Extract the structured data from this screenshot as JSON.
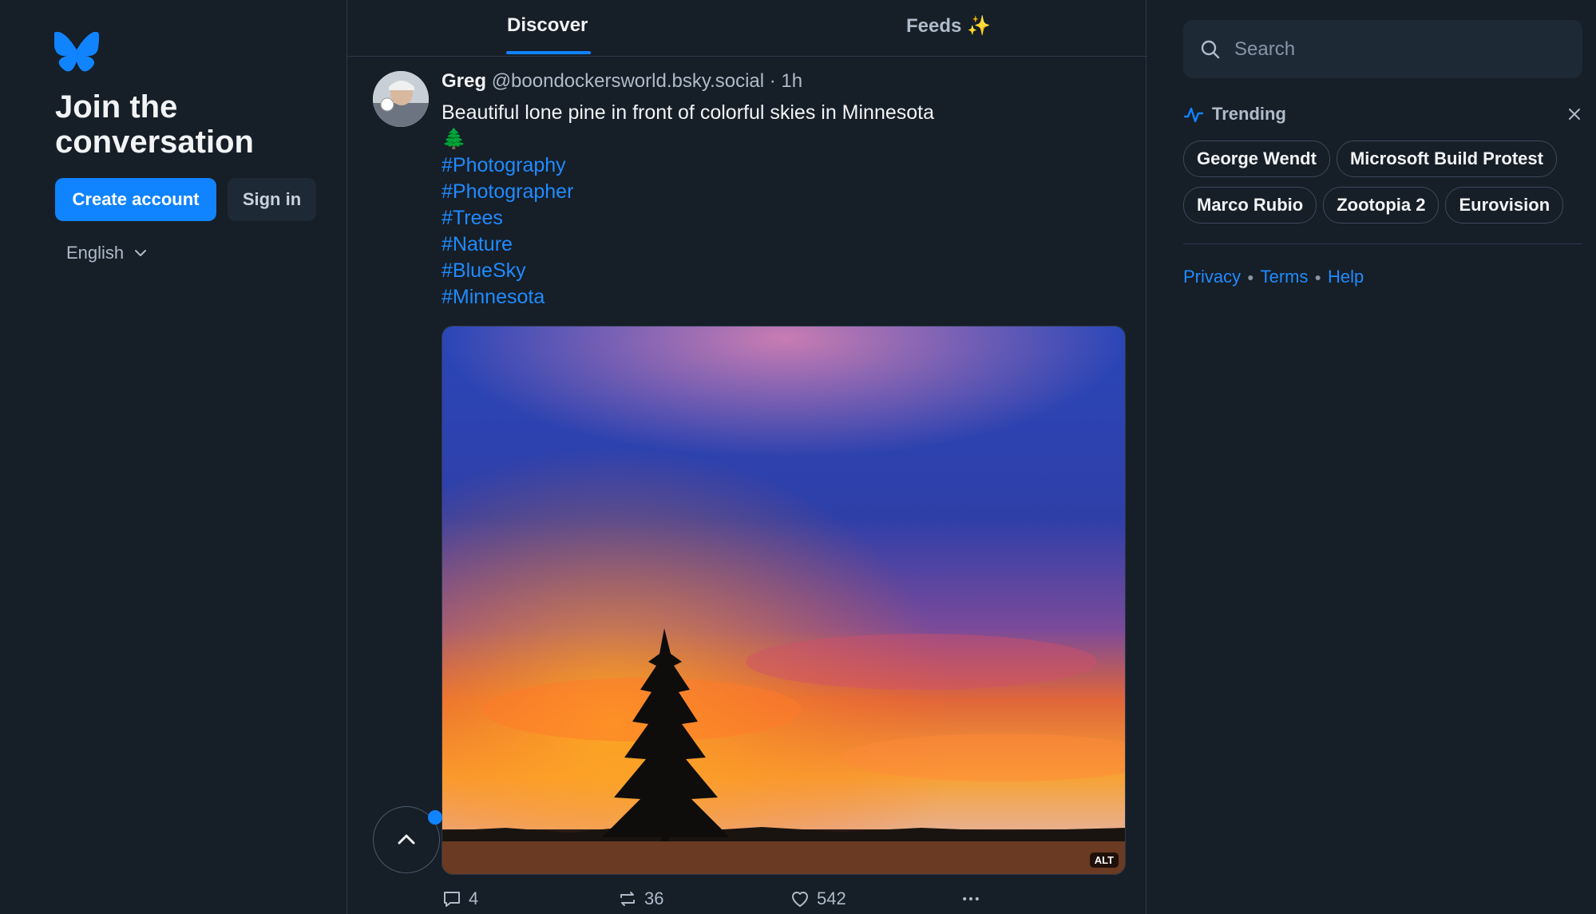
{
  "left": {
    "title": "Join the conversation",
    "create_account": "Create account",
    "sign_in": "Sign in",
    "language": "English"
  },
  "tabs": [
    {
      "label": "Discover",
      "active": true
    },
    {
      "label": "Feeds ✨",
      "active": false
    }
  ],
  "post": {
    "author_name": "Greg",
    "author_handle": "@boondockersworld.bsky.social",
    "time": "· 1h",
    "text": "Beautiful lone pine in front of colorful skies in Minnesota🌲",
    "hashtags": [
      "#Photography",
      "#Photographer",
      "#Trees",
      "#Nature",
      "#BlueSky",
      "#Minnesota"
    ],
    "image_alt_badge": "ALT",
    "replies": "4",
    "reposts": "36",
    "likes": "542"
  },
  "search": {
    "placeholder": "Search"
  },
  "trending": {
    "title": "Trending",
    "topics": [
      "George Wendt",
      "Microsoft Build Protest",
      "Marco Rubio",
      "Zootopia 2",
      "Eurovision"
    ]
  },
  "footer": {
    "privacy": "Privacy",
    "terms": "Terms",
    "help": "Help"
  },
  "colors": {
    "accent": "#1083fe",
    "background": "#161e27",
    "link": "#208bfe"
  },
  "icons": [
    "butterfly-logo-icon",
    "chevron-down-icon",
    "search-icon",
    "trending-icon",
    "close-icon",
    "reply-icon",
    "repost-icon",
    "like-icon",
    "more-icon",
    "chevron-up-icon"
  ]
}
